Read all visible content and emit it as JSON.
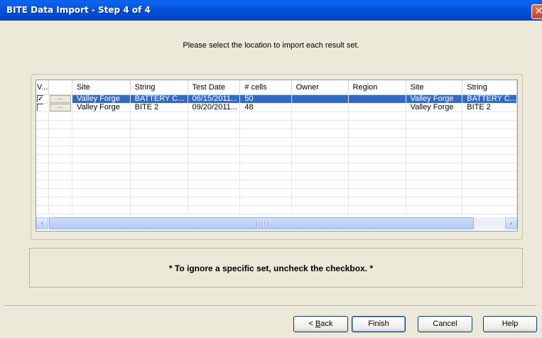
{
  "window": {
    "title": "BITE Data Import - Step 4 of 4",
    "close_glyph": "✕"
  },
  "instruction": "Please select the location to import each result set.",
  "table": {
    "columns": [
      "V...",
      "",
      "Site",
      "String",
      "Test Date",
      "# cells",
      "Owner",
      "Region",
      "Site",
      "String"
    ],
    "rows": [
      {
        "checked": true,
        "selected": true,
        "button": "...",
        "cells": [
          "Valley Forge",
          "BATTERY C...",
          "06/15/2011...",
          "50",
          "",
          "",
          "Valley Forge",
          "BATTERY C..."
        ]
      },
      {
        "checked": false,
        "selected": false,
        "button": "...",
        "cells": [
          "Valley Forge",
          "BITE 2",
          "09/20/2011...",
          "48",
          "",
          "",
          "Valley Forge",
          "BITE 2"
        ]
      }
    ]
  },
  "scrollbar": {
    "left_arrow": "‹",
    "right_arrow": "›",
    "left_icon": "scroll-left-arrow-icon",
    "right_icon": "scroll-right-arrow-icon"
  },
  "note": "* To ignore a specific set, uncheck the checkbox. *",
  "buttons": {
    "back_prefix": "< ",
    "back_mnemonic": "B",
    "back_rest": "ack",
    "finish": "Finish",
    "cancel": "Cancel",
    "help": "Help"
  },
  "colors": {
    "titlebar": "#0454de",
    "selection": "#316ac5",
    "dialog_bg": "#ece9d8"
  }
}
